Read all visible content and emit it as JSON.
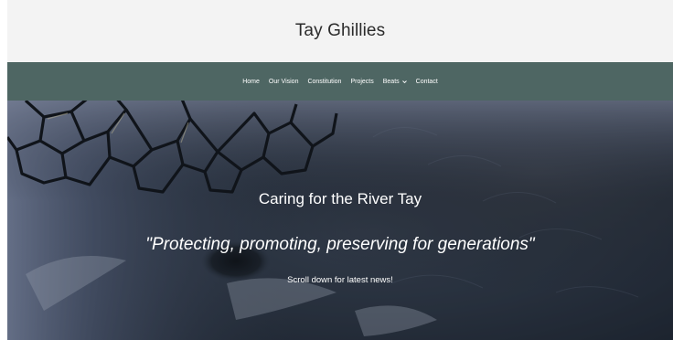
{
  "header": {
    "title": "Tay Ghillies"
  },
  "nav": {
    "items": [
      {
        "label": "Home"
      },
      {
        "label": "Our Vision"
      },
      {
        "label": "Constitution"
      },
      {
        "label": "Projects"
      },
      {
        "label": "Beats",
        "icon": "chevron-down-icon"
      },
      {
        "label": "Contact"
      }
    ]
  },
  "hero": {
    "heading": "Caring for the River Tay",
    "tagline": "\"Protecting, promoting, preserving for generations\"",
    "scroll_hint": "Scroll down for latest news!"
  },
  "colors": {
    "header_bg": "#f3f3f3",
    "nav_bg": "#4e6663",
    "hero_text": "#ffffff"
  }
}
